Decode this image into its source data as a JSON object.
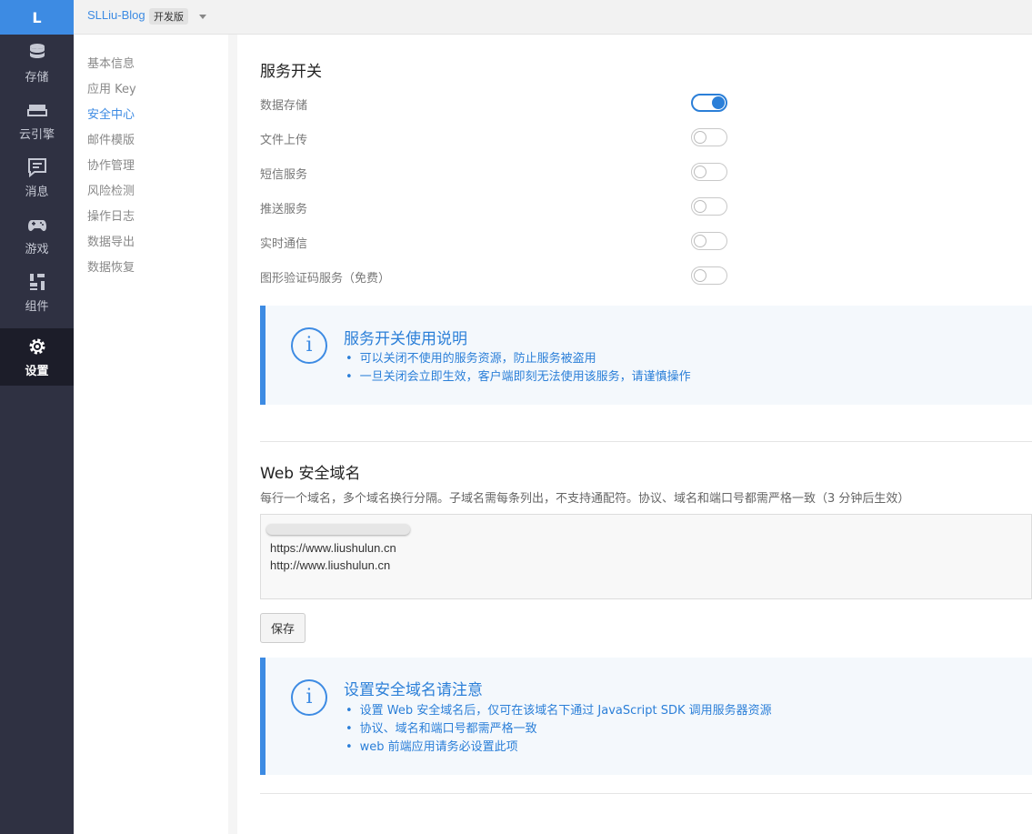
{
  "rail": {
    "logo": "L",
    "items": [
      {
        "label": "存储",
        "icon": "database-icon"
      },
      {
        "label": "云引擎",
        "icon": "server-icon"
      },
      {
        "label": "消息",
        "icon": "message-icon"
      },
      {
        "label": "游戏",
        "icon": "gamepad-icon"
      },
      {
        "label": "组件",
        "icon": "components-icon"
      },
      {
        "label": "设置",
        "icon": "gear-icon"
      }
    ]
  },
  "topbar": {
    "app_name": "SLLiu-Blog",
    "env_badge": "开发版"
  },
  "subnav": {
    "items": [
      "基本信息",
      "应用 Key",
      "安全中心",
      "邮件模版",
      "协作管理",
      "风险检测",
      "操作日志",
      "数据导出",
      "数据恢复"
    ],
    "active": "安全中心"
  },
  "services": {
    "title": "服务开关",
    "switches": [
      {
        "label": "数据存储",
        "on": true
      },
      {
        "label": "文件上传",
        "on": false
      },
      {
        "label": "短信服务",
        "on": false
      },
      {
        "label": "推送服务",
        "on": false
      },
      {
        "label": "实时通信",
        "on": false
      },
      {
        "label": "图形验证码服务（免费）",
        "on": false
      }
    ],
    "notice": {
      "title": "服务开关使用说明",
      "items": [
        "可以关闭不使用的服务资源，防止服务被盗用",
        "一旦关闭会立即生效，客户端即刻无法使用该服务，请谨慎操作"
      ]
    }
  },
  "web_domains": {
    "title": "Web 安全域名",
    "description": "每行一个域名，多个域名换行分隔。子域名需每条列出，不支持通配符。协议、域名和端口号都需严格一致（3 分钟后生效）",
    "domains": [
      "https://www.liushulun.cn",
      "http://www.liushulun.cn"
    ],
    "save_label": "保存",
    "notice": {
      "title": "设置安全域名请注意",
      "items": [
        "设置 Web 安全域名后，仅可在该域名下通过 JavaScript SDK 调用服务器资源",
        "协议、域名和端口号都需严格一致",
        "web 前端应用请务必设置此项"
      ]
    }
  },
  "colors": {
    "accent": "#3d8be3",
    "rail_bg": "#2f3142",
    "rail_active_bg": "#1c1d29"
  }
}
